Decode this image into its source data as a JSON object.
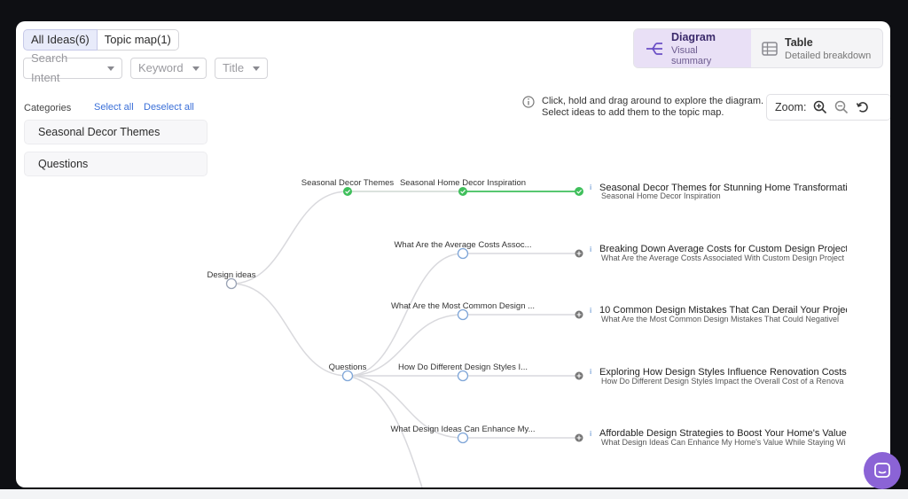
{
  "tabs": [
    {
      "label": "All Ideas(6)",
      "active": true
    },
    {
      "label": "Topic map(1)",
      "active": false
    }
  ],
  "filters": [
    {
      "placeholder": "Search Intent"
    },
    {
      "placeholder": "Keyword"
    },
    {
      "placeholder": "Title"
    }
  ],
  "view_toggle": [
    {
      "title": "Diagram",
      "subtitle": "Visual summary",
      "icon": "diagram-icon",
      "active": true
    },
    {
      "title": "Table",
      "subtitle": "Detailed breakdown",
      "icon": "table-icon",
      "active": false
    }
  ],
  "sidebar": {
    "label": "Categories",
    "select_all": "Select all",
    "deselect_all": "Deselect all",
    "items": [
      {
        "label": "Seasonal Decor Themes"
      },
      {
        "label": "Questions"
      }
    ]
  },
  "hint": {
    "line1": "Click, hold and drag around to explore the diagram.",
    "line2": "Select ideas to add them to the topic map."
  },
  "zoom": {
    "label": "Zoom:"
  },
  "colors": {
    "accent": "#6b4fc6",
    "selected": "#3fbf5b",
    "link_blue": "#3a6fd8",
    "chat": "#8b63d6"
  },
  "diagram": {
    "root": "Design ideas",
    "categories": [
      "Seasonal Decor Themes",
      "Questions"
    ],
    "ideas": [
      {
        "branch": "Seasonal Home Decor Inspiration",
        "title": "Seasonal Decor Themes for Stunning Home Transformati",
        "subtitle": "Seasonal Home Decor Inspiration",
        "selected": true
      },
      {
        "branch": "What Are the Average Costs Assoc...",
        "title": "Breaking Down Average Costs for Custom Design Project",
        "subtitle": "What Are the Average Costs Associated With Custom Design Project",
        "selected": false
      },
      {
        "branch": "What Are the Most Common Design ...",
        "title": "10 Common Design Mistakes That Can Derail Your Projec",
        "subtitle": "What Are the Most Common Design Mistakes That Could Negativel",
        "selected": false
      },
      {
        "branch": "How Do Different Design Styles I...",
        "title": "Exploring How Design Styles Influence Renovation Costs:",
        "subtitle": "How Do Different Design Styles Impact the Overall Cost of a Renova",
        "selected": false
      },
      {
        "branch": "What Design Ideas Can Enhance My...",
        "title": "Affordable Design Strategies to Boost Your Home's Value",
        "subtitle": "What Design Ideas Can Enhance My Home's Value While Staying Wi",
        "selected": false
      }
    ]
  }
}
